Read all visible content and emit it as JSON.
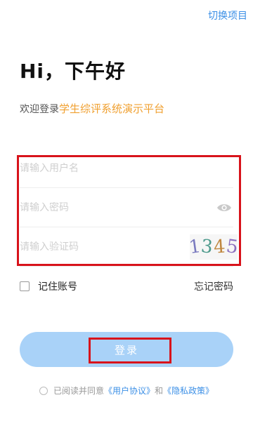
{
  "header": {
    "switch_label": "切换项目"
  },
  "greeting": "Hi，下午好",
  "welcome": {
    "prefix": "欢迎登录",
    "system_name": "学生综评系统演示平台"
  },
  "form": {
    "username_placeholder": "请输入用户名",
    "password_placeholder": "请输入密码",
    "captcha_placeholder": "请输入验证码",
    "captcha_chars": [
      "1",
      "3",
      "4",
      "5"
    ]
  },
  "options": {
    "remember_label": "记住账号",
    "forgot_label": "忘记密码"
  },
  "login_label": "登录",
  "agreement": {
    "prefix": "已阅读并同意",
    "user_agreement": "《用户协议》",
    "and": "和",
    "privacy_policy": "《隐私政策》"
  },
  "colors": {
    "accent_blue": "#3b8fe6",
    "system_name_orange": "#f0a030",
    "login_button_bg": "#a9d2f8",
    "annotation_red": "#d8131b"
  },
  "icons": {
    "password_toggle": "eye-icon"
  }
}
